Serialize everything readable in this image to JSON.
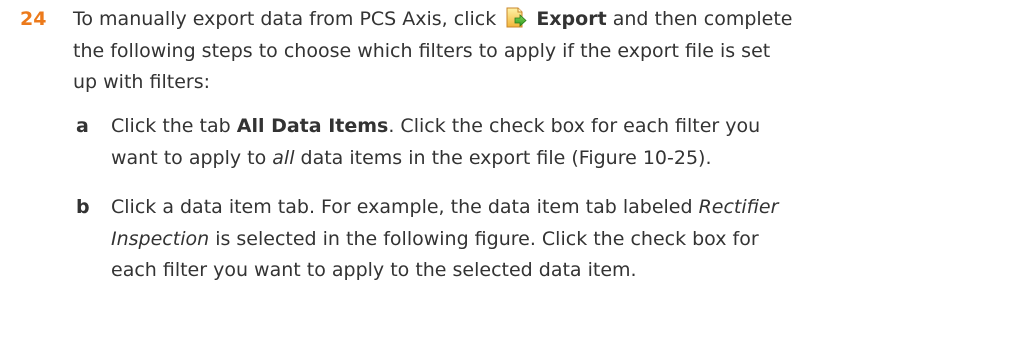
{
  "step": {
    "number": "24",
    "text_before_icon": "To manually export data from PCS Axis, click",
    "export_label": "Export",
    "text_after_export": "and then complete the following steps to choose which filters to apply if the export file is set up with filters:",
    "icon": "export-icon"
  },
  "substeps": [
    {
      "letter": "a",
      "pre": "Click the tab",
      "tab_name": "All Data Items",
      "mid": ". Click the check box for each filter you want to apply to",
      "emphasis": "all",
      "post": "data items in the export file (Figure 10-25)."
    },
    {
      "letter": "b",
      "pre": "Click a data item tab. For example, the data item tab labeled",
      "emphasis": "Rectifier Inspection",
      "post": "is selected in the following figure. Click the check box for each filter you want to apply to the selected data item."
    }
  ],
  "colors": {
    "step_number": "#ec7a1b",
    "body_text": "#333333"
  }
}
